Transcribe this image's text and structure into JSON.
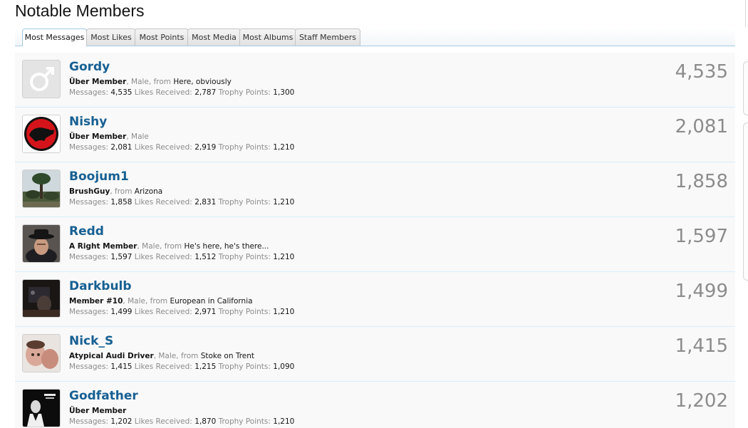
{
  "page_title": "Notable Members",
  "tabs": [
    {
      "label": "Most Messages",
      "active": true
    },
    {
      "label": "Most Likes",
      "active": false
    },
    {
      "label": "Most Points",
      "active": false
    },
    {
      "label": "Most Media",
      "active": false
    },
    {
      "label": "Most Albums",
      "active": false
    },
    {
      "label": "Staff Members",
      "active": false
    }
  ],
  "stat_labels": {
    "messages": "Messages:",
    "likes": "Likes Received:",
    "points": "Trophy Points:"
  },
  "members": [
    {
      "username": "Gordy",
      "avatar": "male-placeholder-icon",
      "title": "Über Member",
      "gender": "Male",
      "from_label": "from",
      "location": "Here, obviously",
      "messages": "4,535",
      "likes": "2,787",
      "points": "1,300",
      "count": "4,535"
    },
    {
      "username": "Nishy",
      "avatar": "red-panther-logo",
      "title": "Über Member",
      "gender": "Male",
      "from_label": "",
      "location": "",
      "messages": "2,081",
      "likes": "2,919",
      "points": "1,210",
      "count": "2,081"
    },
    {
      "username": "Boojum1",
      "avatar": "tree-photo",
      "title": "BrushGuy",
      "gender": "",
      "from_label": "from",
      "location": "Arizona",
      "messages": "1,858",
      "likes": "2,831",
      "points": "1,210",
      "count": "1,858"
    },
    {
      "username": "Redd",
      "avatar": "man-in-hat-photo",
      "title": "A Right Member",
      "gender": "Male",
      "from_label": "from",
      "location": "He's here, he's there...",
      "messages": "1,597",
      "likes": "1,512",
      "points": "1,210",
      "count": "1,597"
    },
    {
      "username": "Darkbulb",
      "avatar": "dark-photo",
      "title": "Member #10",
      "gender": "Male",
      "from_label": "from",
      "location": "European in California",
      "messages": "1,499",
      "likes": "2,971",
      "points": "1,210",
      "count": "1,499"
    },
    {
      "username": "Nick_S",
      "avatar": "baby-photo",
      "title": "Atypical Audi Driver",
      "gender": "Male",
      "from_label": "from",
      "location": "Stoke on Trent",
      "messages": "1,415",
      "likes": "1,215",
      "points": "1,090",
      "count": "1,415"
    },
    {
      "username": "Godfather",
      "avatar": "godfather-poster",
      "title": "Über Member",
      "gender": "",
      "from_label": "",
      "location": "",
      "messages": "1,202",
      "likes": "1,870",
      "points": "1,210",
      "count": "1,202"
    }
  ],
  "colors": {
    "username": "#176093",
    "muted": "#8c8c8c",
    "row_bg": "#f9f9f9",
    "divider": "#d7edfc"
  }
}
